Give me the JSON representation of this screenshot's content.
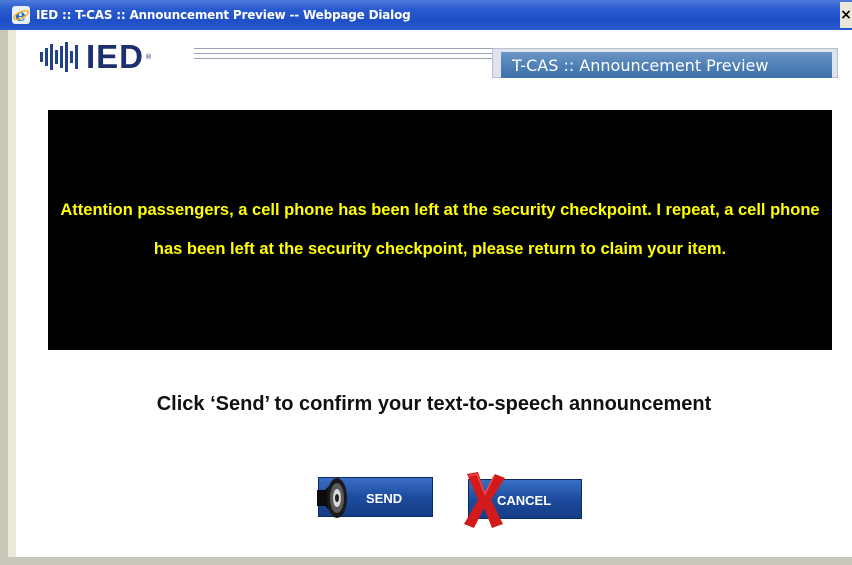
{
  "window": {
    "title": "IED :: T-CAS :: Announcement Preview -- Webpage Dialog",
    "close_label": "×",
    "icon": "ie-icon"
  },
  "header": {
    "logo_text": "IED",
    "logo_reg": "®",
    "tab_title": "T-CAS :: Announcement Preview"
  },
  "announcement": {
    "text": "Attention passengers, a cell phone has been left at the security checkpoint. I repeat, a cell phone has been left at the security checkpoint, please return to claim your item."
  },
  "instruction": "Click ‘Send’ to confirm your text-to-speech announcement",
  "buttons": {
    "send_label": "SEND",
    "send_icon": "speaker-icon",
    "cancel_label": "CANCEL",
    "cancel_icon": "red-x-icon"
  },
  "colors": {
    "titlebar": "#1d4fc6",
    "announcement_bg": "#000000",
    "announcement_text": "#ffff00",
    "button_blue": "#1e4c9e",
    "cancel_x": "#d11a1a"
  }
}
